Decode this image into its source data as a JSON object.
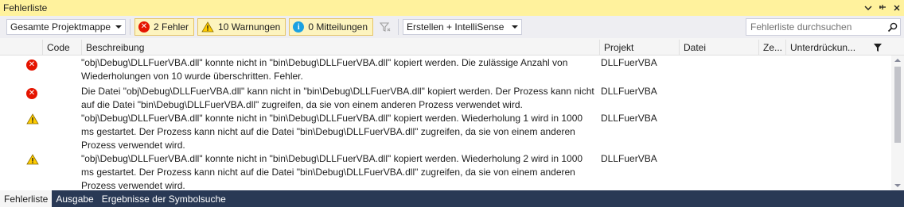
{
  "window": {
    "title": "Fehlerliste",
    "menu_icon": "chevron-down-icon",
    "pin_icon": "pin-icon",
    "close_icon": "close-icon"
  },
  "toolbar": {
    "scope": "Gesamte Projektmappe",
    "errors_label": "2 Fehler",
    "warnings_label": "10 Warnungen",
    "messages_label": "0 Mitteilungen",
    "build_filter": "Erstellen + IntelliSense",
    "search_placeholder": "Fehlerliste durchsuchen"
  },
  "columns": {
    "code": "Code",
    "description": "Beschreibung",
    "project": "Projekt",
    "file": "Datei",
    "line": "Ze...",
    "suppression": "Unterdrückun..."
  },
  "rows": [
    {
      "severity": "error",
      "description": "\"obj\\Debug\\DLLFuerVBA.dll\" konnte nicht in \"bin\\Debug\\DLLFuerVBA.dll\" kopiert werden. Die zulässige Anzahl von Wiederholungen von 10 wurde überschritten. Fehler.",
      "project": "DLLFuerVBA"
    },
    {
      "severity": "error",
      "description": "Die Datei \"obj\\Debug\\DLLFuerVBA.dll\" kann nicht in \"bin\\Debug\\DLLFuerVBA.dll\" kopiert werden. Der Prozess kann nicht auf die Datei \"bin\\Debug\\DLLFuerVBA.dll\" zugreifen, da sie von einem anderen Prozess verwendet wird.",
      "project": "DLLFuerVBA"
    },
    {
      "severity": "warning",
      "description": "\"obj\\Debug\\DLLFuerVBA.dll\" konnte nicht in \"bin\\Debug\\DLLFuerVBA.dll\" kopiert werden. Wiederholung 1 wird in 1000 ms gestartet. Der Prozess kann nicht auf die Datei \"bin\\Debug\\DLLFuerVBA.dll\" zugreifen, da sie von einem anderen Prozess verwendet wird.",
      "project": "DLLFuerVBA"
    },
    {
      "severity": "warning",
      "description": "\"obj\\Debug\\DLLFuerVBA.dll\" konnte nicht in \"bin\\Debug\\DLLFuerVBA.dll\" kopiert werden. Wiederholung 2 wird in 1000 ms gestartet. Der Prozess kann nicht auf die Datei \"bin\\Debug\\DLLFuerVBA.dll\" zugreifen, da sie von einem anderen Prozess verwendet wird.",
      "project": "DLLFuerVBA"
    }
  ],
  "tabs": [
    {
      "label": "Fehlerliste"
    },
    {
      "label": "Ausgabe"
    },
    {
      "label": "Ergebnisse der Symbolsuche"
    }
  ],
  "colors": {
    "title_bar": "#fff29d",
    "error": "#e51400",
    "warning": "#ffcc00",
    "info": "#1ba1e2",
    "tab_strip": "#293955"
  }
}
